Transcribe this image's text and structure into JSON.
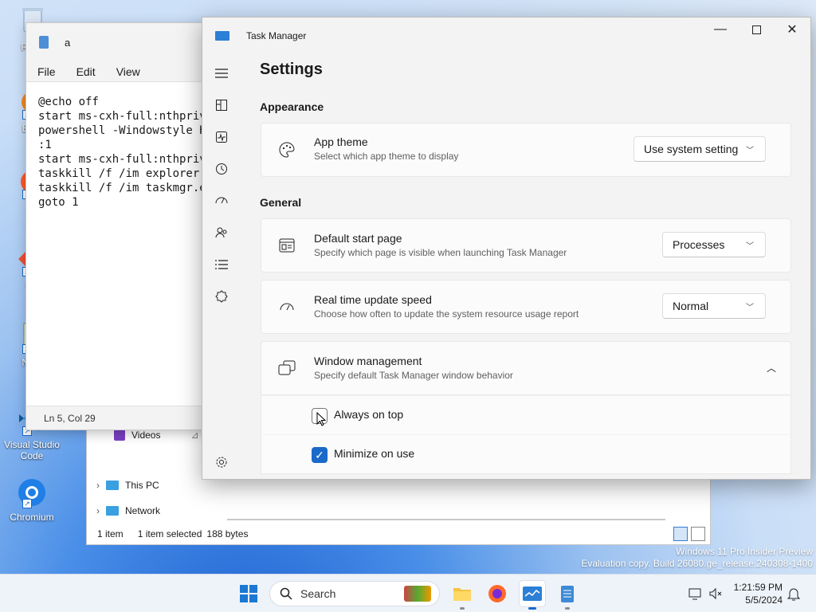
{
  "desktop": {
    "icons": [
      {
        "label": "Recy",
        "icon": "recycle-bin-icon"
      },
      {
        "label": "Ever",
        "icon": "everything-icon"
      },
      {
        "label": "Fi",
        "icon": "firefox-icon"
      },
      {
        "label": "Git",
        "icon": "git-icon"
      },
      {
        "label": "Note",
        "icon": "notepad-icon"
      },
      {
        "label": "Visual Studio Code",
        "icon": "vscode-icon"
      },
      {
        "label": "Chromium",
        "icon": "chromium-icon"
      }
    ],
    "watermark": {
      "line1": "Windows 11 Pro Insider Preview",
      "line2": "Evaluation copy. Build 26080.ge_release.240308-1400"
    }
  },
  "notepad": {
    "tab_title": "a",
    "menu": [
      "File",
      "Edit",
      "View"
    ],
    "content": "@echo off\nstart ms-cxh-full:nthpriva\npowershell -Windowstyle Hi\n:1\nstart ms-cxh-full:nthpriva\ntaskkill /f /im explorer.e\ntaskkill /f /im taskmgr.ex\ngoto 1",
    "status": "Ln 5, Col 29"
  },
  "explorer": {
    "nav": [
      {
        "label": "Videos",
        "icon": "videos-folder-icon"
      },
      {
        "label": "This PC",
        "icon": "this-pc-icon"
      },
      {
        "label": "Network",
        "icon": "network-icon"
      }
    ],
    "status": {
      "count": "1 item",
      "selected": "1 item selected",
      "size": "188 bytes"
    }
  },
  "task_manager": {
    "title": "Task Manager",
    "page_title": "Settings",
    "sections": {
      "appearance": "Appearance",
      "general": "General"
    },
    "app_theme": {
      "title": "App theme",
      "desc": "Select which app theme to display",
      "value": "Use system setting"
    },
    "default_start_page": {
      "title": "Default start page",
      "desc": "Specify which page is visible when launching Task Manager",
      "value": "Processes"
    },
    "update_speed": {
      "title": "Real time update speed",
      "desc": "Choose how often to update the system resource usage report",
      "value": "Normal"
    },
    "window_management": {
      "title": "Window management",
      "desc": "Specify default Task Manager window behavior"
    },
    "always_on_top": {
      "label": "Always on top",
      "checked": false
    },
    "minimize_on_use": {
      "label": "Minimize on use",
      "checked": true
    }
  },
  "taskbar": {
    "search_placeholder": "Search",
    "time": "1:21:59 PM",
    "date": "5/5/2024"
  },
  "colors": {
    "accent": "#1b6ac9"
  }
}
